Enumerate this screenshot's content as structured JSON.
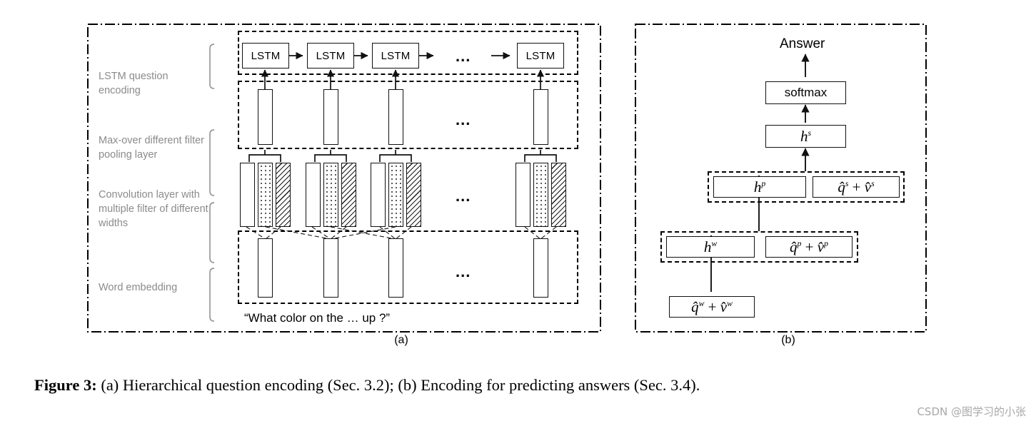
{
  "figure": {
    "caption_label": "Figure 3:",
    "caption_text": " (a) Hierarchical question encoding (Sec. 3.2); (b) Encoding for predicting answers (Sec. 3.4).",
    "watermark": "CSDN @图学习的小张",
    "colors": {
      "stroke": "#111111",
      "side_label": "#8b8b8b",
      "background": "#ffffff",
      "watermark": "#a8a8a8"
    }
  },
  "panel_a": {
    "sub_caption": "(a)",
    "side_labels": [
      {
        "id": "lstm-question-encoding",
        "text": "LSTM question encoding"
      },
      {
        "id": "max-over-pooling",
        "text": "Max-over different filter pooling layer"
      },
      {
        "id": "convolution-layer",
        "text": "Convolution layer with multiple filter of different widths"
      },
      {
        "id": "word-embedding",
        "text": "Word embedding"
      }
    ],
    "lstm_cells": [
      {
        "label": "LSTM"
      },
      {
        "label": "LSTM"
      },
      {
        "label": "LSTM"
      },
      {
        "label": "LSTM"
      }
    ],
    "lstm_ellipsis": "...",
    "pooling_ellipsis": "...",
    "convolution_ellipsis": "...",
    "embedding_ellipsis": "...",
    "filter_types": [
      "plain",
      "dotted",
      "hatched"
    ],
    "question_words": [
      "“What",
      "color",
      "on",
      "the",
      "…",
      "up",
      "?”"
    ],
    "question_text": "“What    color    on   the   …       up  ?”"
  },
  "panel_b": {
    "sub_caption": "(b)",
    "answer_label": "Answer",
    "softmax_label": "softmax",
    "nodes": [
      {
        "id": "h-s",
        "base": "h",
        "sup": "s",
        "plus": false
      },
      {
        "id": "h-p",
        "base": "h",
        "sup": "p",
        "plus": false
      },
      {
        "id": "qs-vs",
        "base": "q̂",
        "sup": "s",
        "plus": true,
        "base2": "v̂",
        "sup2": "s"
      },
      {
        "id": "h-w",
        "base": "h",
        "sup": "w",
        "plus": false
      },
      {
        "id": "qp-vp",
        "base": "q̂",
        "sup": "p",
        "plus": true,
        "base2": "v̂",
        "sup2": "p"
      },
      {
        "id": "qw-vw",
        "base": "q̂",
        "sup": "w",
        "plus": true,
        "base2": "v̂",
        "sup2": "w"
      }
    ]
  }
}
